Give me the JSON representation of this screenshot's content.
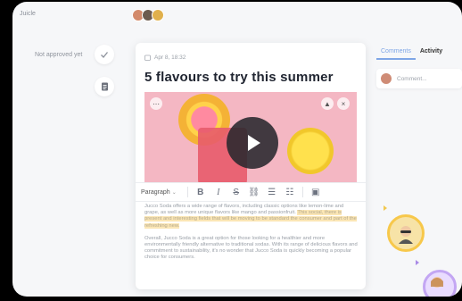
{
  "topbar": {
    "brand": "Juicle"
  },
  "left": {
    "status": "Not approved yet"
  },
  "article": {
    "date": "Apr 8, 18:32",
    "title": "5 flavours to try this summer",
    "toolbar": {
      "paragraph": "Paragraph"
    },
    "para1_a": "Jucco Soda offers a wide range of flavors, including classic options like lemon-lime and grape, as well as more unique flavors like mango and passionfruit.",
    "para1_b": "This social, there is present and interesting fields that will be moving to be standard the consumer and part of the refreshing new.",
    "para2": "Overall, Jucco Soda is a great option for those looking for a healthier and more environmentally friendly alternative to traditional sodas. With its range of delicious flavors and commitment to sustainability, it's no wonder that Jucco Soda is quickly becoming a popular choice for consumers."
  },
  "right": {
    "tab_comments": "Comments",
    "tab_activity": "Activity",
    "comment_placeholder": "Comment..."
  },
  "colors": {
    "accent": "#7fa6e6",
    "highlight": "#fbe6b5",
    "play_bg": "#28282d"
  },
  "icons": [
    "check-icon",
    "document-icon",
    "calendar-icon",
    "play-icon",
    "bold-icon",
    "italic-icon",
    "strikethrough-icon",
    "link-icon",
    "bullet-list-icon",
    "numbered-list-icon",
    "image-icon"
  ]
}
